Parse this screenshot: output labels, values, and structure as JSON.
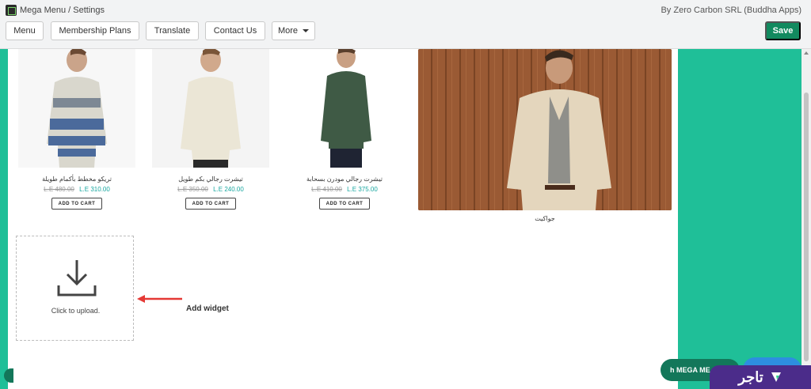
{
  "header": {
    "breadcrumb": "Mega Menu / Settings",
    "by_line": "By Zero Carbon SRL (Buddha Apps)"
  },
  "toolbar": {
    "menu": "Menu",
    "membership_plans": "Membership Plans",
    "translate": "Translate",
    "contact_us": "Contact Us",
    "more": "More",
    "save": "Save"
  },
  "products": [
    {
      "name": "تريكو مخطط بأكمام طويلة",
      "old_price": "L.E 480.00",
      "new_price": "L.E 310.00",
      "button": "ADD TO CART"
    },
    {
      "name": "تيشرت رجالي بكم طويل",
      "old_price": "L.E 350.00",
      "new_price": "L.E 240.00",
      "button": "ADD TO CART"
    },
    {
      "name": "تيشرت رجالي مودرن بسحابة",
      "old_price": "L.E 410.00",
      "new_price": "L.E 375.00",
      "button": "ADD TO CART"
    }
  ],
  "banner": {
    "caption": "جواكيت"
  },
  "upload": {
    "label": "Click to upload."
  },
  "add_widget": "Add widget",
  "overlays": {
    "mega_pill": "h MEGA ME",
    "brand": "تاجر"
  },
  "colors": {
    "accent": "#1fbf98",
    "save": "#128a5f",
    "price": "#19a7a0",
    "brand_badge": "#4b2c8a",
    "arrow": "#e53935"
  }
}
